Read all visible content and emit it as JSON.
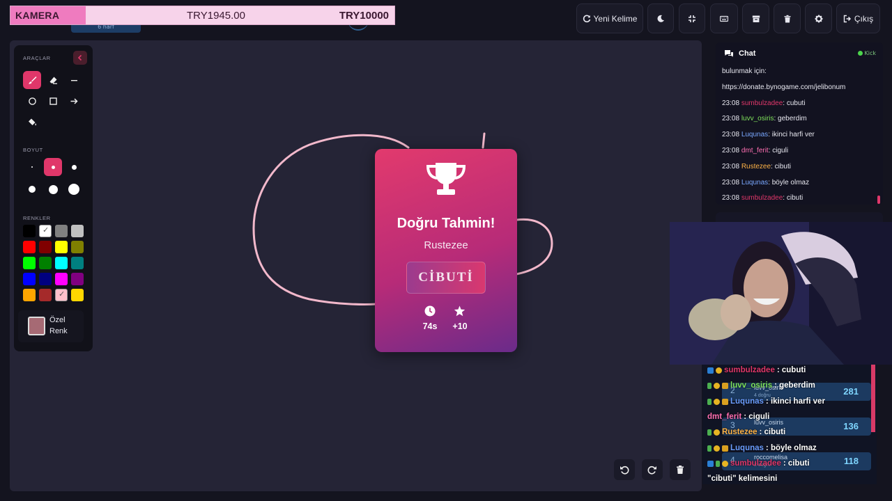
{
  "donation": {
    "label": "KAMERA",
    "current": "TRY1945.00",
    "goal": "TRY10000",
    "progress": 0.1945
  },
  "hint": {
    "text": "6 harf"
  },
  "toolbar": {
    "new_word_label": "Yeni Kelime",
    "logout_label": "Çıkış",
    "icons": [
      "refresh-icon",
      "moon-icon",
      "fullscreen-icon",
      "keyboard-icon",
      "archive-icon",
      "trash-icon",
      "gear-icon",
      "logout-icon"
    ]
  },
  "tools": {
    "section_tools": "ARAÇLAR",
    "section_size": "BOYUT",
    "section_colors": "RENKLER",
    "custom_color_line1": "Özel",
    "custom_color_line2": "Renk",
    "custom_color_value": "#a66a74",
    "colors": [
      "#000000",
      "#ffffff",
      "#808080",
      "#c0c0c0",
      "#ff0000",
      "#800000",
      "#ffff00",
      "#808000",
      "#00ff00",
      "#008000",
      "#00ffff",
      "#008080",
      "#0000ff",
      "#000080",
      "#ff00ff",
      "#800080",
      "#ffa500",
      "#a52a2a",
      "#ffc0cb",
      "#ffd700"
    ]
  },
  "card": {
    "title": "Doğru Tahmin!",
    "user": "Rustezee",
    "word": "CİBUTİ",
    "time": "74s",
    "points": "+10"
  },
  "chat": {
    "title": "Chat",
    "platform": "Kick",
    "lines": [
      {
        "time": "",
        "user": "",
        "msg": "bulunmak için:",
        "color": "#e8e8f0"
      },
      {
        "time": "",
        "user": "",
        "msg": "https://donate.bynogame.com/jelibonum",
        "color": "#e8e8f0"
      },
      {
        "time": "23:08",
        "user": "sumbulzadee",
        "msg": ": cubuti",
        "color": "#e0376a"
      },
      {
        "time": "23:08",
        "user": "luvv_osiris",
        "msg": ": geberdim",
        "color": "#7ee05a"
      },
      {
        "time": "23:08",
        "user": "Luqunas",
        "msg": ": ikinci harfi ver",
        "color": "#7aa8ff"
      },
      {
        "time": "23:08",
        "user": "dmt_ferit",
        "msg": ": ciguli",
        "color": "#ff6fb2"
      },
      {
        "time": "23:08",
        "user": "Rustezee",
        "msg": ": cibuti",
        "color": "#ffb347"
      },
      {
        "time": "23:08",
        "user": "Luqunas",
        "msg": ": böyle olmaz",
        "color": "#7aa8ff"
      },
      {
        "time": "23:08",
        "user": "sumbulzadee",
        "msg": ": cibuti",
        "color": "#e0376a"
      }
    ]
  },
  "leaderboard": [
    {
      "rank": "2",
      "name": "luvv_osiris",
      "sub": "4 doğru",
      "score": "281"
    },
    {
      "rank": "3",
      "name": "luvv_osiris",
      "sub": "",
      "score": "136"
    },
    {
      "rank": "4",
      "name": "roccomelisa",
      "sub": "2 doğru",
      "score": "118"
    }
  ],
  "overlay_chat": [
    {
      "user": "sumbulzadee",
      "msg": ": cubuti",
      "color": "#e0376a"
    },
    {
      "user": "luvv_osiris",
      "msg": ": geberdim",
      "color": "#7ee05a"
    },
    {
      "user": "Luqunas",
      "msg": ": ikinci harfi ver",
      "color": "#6b9dff"
    },
    {
      "user": "dmt_ferit",
      "msg": ": ciguli",
      "color": "#ff6fb2"
    },
    {
      "user": "Rustezee",
      "msg": ": cibuti",
      "color": "#ffb347"
    },
    {
      "user": "Luqunas",
      "msg": ": böyle olmaz",
      "color": "#6b9dff"
    },
    {
      "user": "sumbulzadee",
      "msg": ": cibuti",
      "color": "#e0376a"
    },
    {
      "user": "",
      "msg": "\"cibuti\" kelimesini",
      "color": "#ffffff"
    }
  ]
}
